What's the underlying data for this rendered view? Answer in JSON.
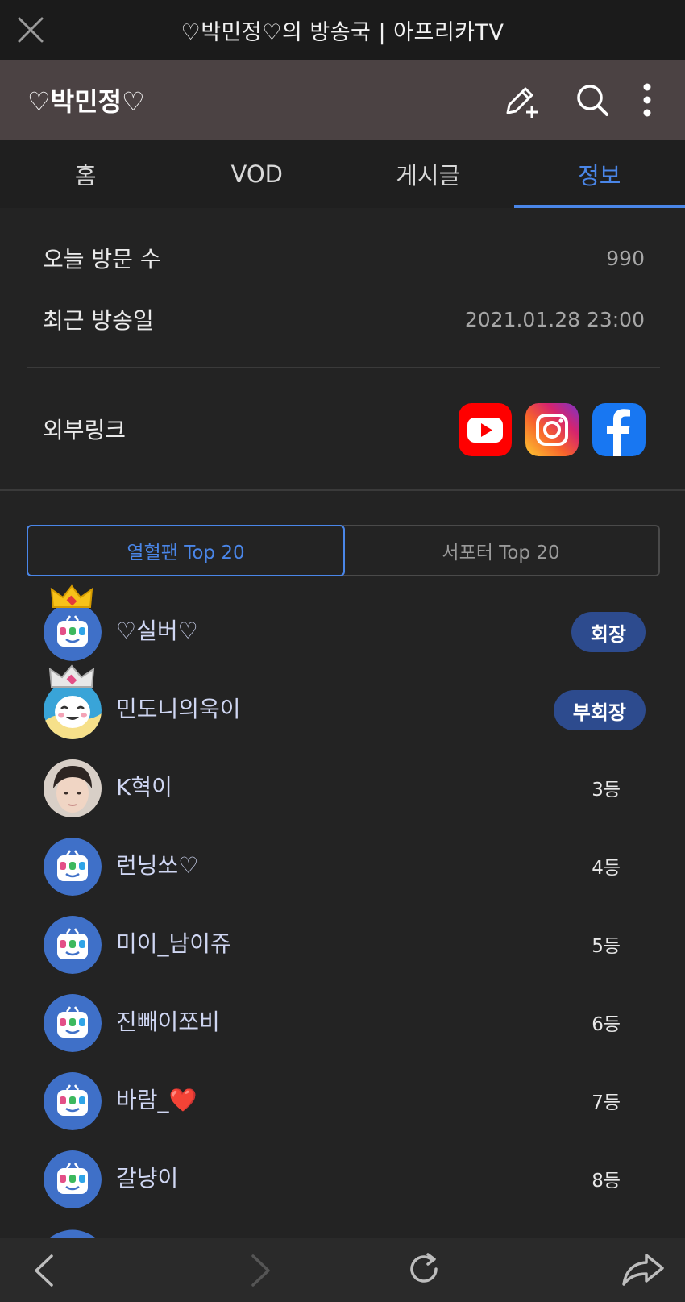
{
  "window": {
    "title": "♡박민정♡의 방송국 | 아프리카TV"
  },
  "header": {
    "channel_name": "♡박민정♡"
  },
  "tabs": [
    {
      "label": "홈"
    },
    {
      "label": "VOD"
    },
    {
      "label": "게시글"
    },
    {
      "label": "정보",
      "active": true
    }
  ],
  "info": {
    "visitors_label": "오늘 방문 수",
    "visitors_value": "990",
    "last_broadcast_label": "최근 방송일",
    "last_broadcast_value": "2021.01.28 23:00",
    "external_links_label": "외부링크",
    "links": [
      "youtube-icon",
      "instagram-icon",
      "facebook-icon"
    ]
  },
  "ranking": {
    "tabs": [
      {
        "label": "열혈팬 Top 20",
        "active": true
      },
      {
        "label": "서포터 Top 20"
      }
    ],
    "fans": [
      {
        "name": "♡실버♡",
        "badge": "회장",
        "avatar": "tv-default-icon",
        "crown": "gold"
      },
      {
        "name": "민도니의욱이",
        "badge": "부회장",
        "avatar": "cartoon-face",
        "crown": "silver"
      },
      {
        "name": "K혁이",
        "rank": "3등",
        "avatar": "photo"
      },
      {
        "name": "런닝쏘♡",
        "rank": "4등",
        "avatar": "tv-default-icon"
      },
      {
        "name": "미이_남이쥬",
        "rank": "5등",
        "avatar": "tv-default-icon"
      },
      {
        "name": "진빼이쪼비",
        "rank": "6등",
        "avatar": "tv-default-icon"
      },
      {
        "name": "바람_❤️",
        "rank": "7등",
        "avatar": "tv-default-icon"
      },
      {
        "name": "갈냥이",
        "rank": "8등",
        "avatar": "tv-default-icon"
      }
    ]
  },
  "colors": {
    "accent": "#4a86e8",
    "badge": "#2d4b8e",
    "header": "#4b4243",
    "background": "#232323"
  }
}
